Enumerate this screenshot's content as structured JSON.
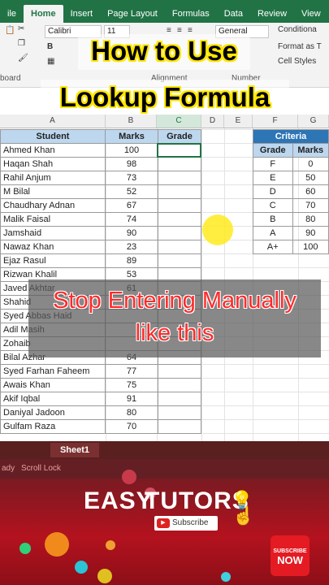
{
  "ribbon": {
    "tabs": [
      "ile",
      "Home",
      "Insert",
      "Page Layout",
      "Formulas",
      "Data",
      "Review",
      "View"
    ],
    "active_tab": "Home",
    "font_name": "Calibri",
    "font_size": "11",
    "number_format": "General",
    "conditional": "Conditiona",
    "format_as": "Format as T",
    "cell_styles": "Cell Styles",
    "group_clipboard": "board",
    "group_alignment": "Alignment",
    "group_number": "Number"
  },
  "overlay": {
    "title_line1": "How to Use",
    "title_line2": "Lookup Formula",
    "stop_line1": "Stop Entering Manually",
    "stop_line2": "like this"
  },
  "columns": [
    "A",
    "B",
    "C",
    "D",
    "E",
    "F",
    "G"
  ],
  "student_table": {
    "headers": [
      "Student",
      "Marks",
      "Grade"
    ],
    "rows": [
      [
        "Ahmed Khan",
        "100"
      ],
      [
        "Haqan Shah",
        "98"
      ],
      [
        "Rahil Anjum",
        "73"
      ],
      [
        "M Bilal",
        "52"
      ],
      [
        "Chaudhary Adnan",
        "67"
      ],
      [
        "Malik Faisal",
        "74"
      ],
      [
        "Jamshaid",
        "90"
      ],
      [
        "Nawaz Khan",
        "23"
      ],
      [
        "Ejaz Rasul",
        "89"
      ],
      [
        "Rizwan Khalil",
        "53"
      ],
      [
        "Javed Akhtar",
        "61"
      ],
      [
        "Shahid",
        ""
      ],
      [
        "Syed Abbas Haid",
        ""
      ],
      [
        "Adil Masih",
        ""
      ],
      [
        "Zohaib",
        ""
      ],
      [
        "Bilal Azhar",
        "64"
      ],
      [
        "Syed Farhan Faheem",
        "77"
      ],
      [
        "Awais Khan",
        "75"
      ],
      [
        "Akif Iqbal",
        "91"
      ],
      [
        "Daniyal Jadoon",
        "80"
      ],
      [
        "Gulfam Raza",
        "70"
      ]
    ]
  },
  "criteria_table": {
    "title": "Criteria",
    "headers": [
      "Grade",
      "Marks"
    ],
    "rows": [
      [
        "F",
        "0"
      ],
      [
        "E",
        "50"
      ],
      [
        "D",
        "60"
      ],
      [
        "C",
        "70"
      ],
      [
        "B",
        "80"
      ],
      [
        "A",
        "90"
      ],
      [
        "A+",
        "100"
      ]
    ]
  },
  "sheet": {
    "tab_name": "Sheet1",
    "status_ready": "ady",
    "status_scroll": "Scroll Lock"
  },
  "branding": {
    "word1": "EASY",
    "word2": "TUTORS",
    "subscribe": "Subscribe",
    "badge_line1": "SUBSCRIBE",
    "badge_line2": "NOW"
  },
  "colors": {
    "excel_green": "#217346",
    "header_blue": "#bdd7ee",
    "criteria_blue": "#2e75b6",
    "title_yellow": "#ffe600",
    "stop_red": "#ff2a2a",
    "banner_red": "#b3121e"
  }
}
